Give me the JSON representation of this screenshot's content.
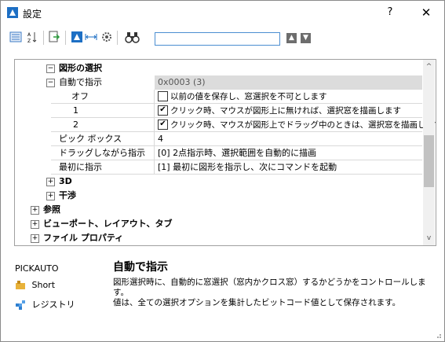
{
  "window": {
    "title": "設定",
    "help_label": "?",
    "close_label": "✕"
  },
  "toolbar": {
    "search_value": "",
    "up_label": "▲",
    "down_label": "▼"
  },
  "tree": {
    "selection_group": "図形の選択",
    "auto_label": "自動で指示",
    "auto_value": "0x0003 (3)",
    "opt_off_label": "オフ",
    "opt_off_text": "以前の値を保存し、窓選択を不可とします",
    "opt_1_label": "1",
    "opt_1_text": "クリック時、マウスが図形上に無ければ、選択窓を描画します",
    "opt_2_label": "2",
    "opt_2_text": "クリック時、マウスが図形上でドラッグ中のときは、選択窓を描画します",
    "pickbox_label": "ピック ボックス",
    "pickbox_value": "4",
    "drag_label": "ドラッグしながら指示",
    "drag_value": "[0] 2点指示時、選択範囲を自動的に描画",
    "first_label": "最初に指示",
    "first_value": "[1] 最初に図形を指示し、次にコマンドを起動",
    "g3d": "3D",
    "interference": "干渉",
    "reference": "参照",
    "viewport": "ビューポート、レイアウト、タブ",
    "fileprops": "ファイル プロパティ"
  },
  "detail": {
    "var_name": "PICKAUTO",
    "heading": "自動で指示",
    "short_label": "Short",
    "registry_label": "レジストリ",
    "desc_line1": "図形選択時に、自動的に窓選択（窓内かクロス窓）するかどうかをコントロールします。",
    "desc_line2": "値は、全ての選択オプションを集計したビットコード値として保存されます。"
  },
  "option_states": {
    "off": false,
    "bit1": true,
    "bit2": true
  }
}
